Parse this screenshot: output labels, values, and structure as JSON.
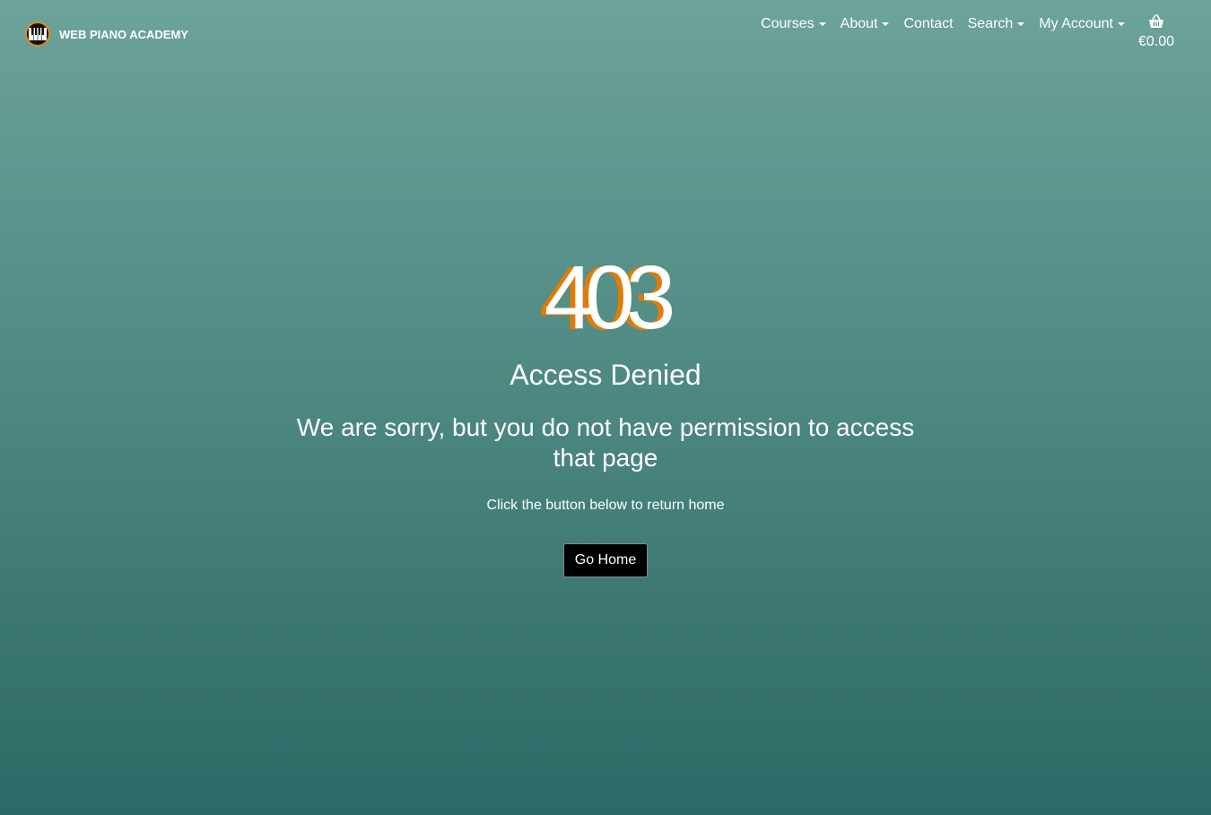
{
  "header": {
    "brand_name": "WEB PIANO ACADEMY",
    "brand_icon": "piano-keys-icon",
    "nav": [
      {
        "label": "Courses",
        "has_dropdown": true
      },
      {
        "label": "About",
        "has_dropdown": true
      },
      {
        "label": "Contact",
        "has_dropdown": false
      },
      {
        "label": "Search",
        "has_dropdown": true
      },
      {
        "label": "My Account",
        "has_dropdown": true
      }
    ],
    "cart": {
      "icon": "shopping-basket-icon",
      "total": "€0.00"
    }
  },
  "error": {
    "code": "403",
    "title": "Access Denied",
    "message": "We are sorry, but you do not have permission to access that page",
    "hint": "Click the button below to return home",
    "button_label": "Go Home"
  },
  "colors": {
    "accent_orange": "#e07c06",
    "background_top": "#6ca39a",
    "background_bottom": "#2c6865",
    "button_bg": "#000000"
  }
}
